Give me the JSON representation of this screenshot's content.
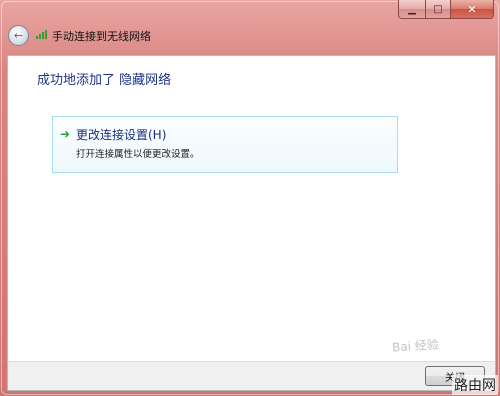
{
  "window": {
    "minimize_glyph": "▁",
    "maximize_glyph": "□",
    "close_glyph": "✕"
  },
  "header": {
    "back_icon": "back-arrow-icon",
    "network_icon": "wireless-signal-icon",
    "title": "手动连接到无线网络"
  },
  "main": {
    "heading": "成功地添加了 隐藏网络",
    "option": {
      "icon": "green-arrow-icon",
      "title": "更改连接设置(H)",
      "description": "打开连接属性以便更改设置。"
    }
  },
  "footer": {
    "close_label": "关闭"
  },
  "watermark": {
    "text": "Bai 经验",
    "site_mark": "路由网"
  },
  "colors": {
    "frame": "#d98a88",
    "heading": "#1e3287",
    "option_border": "#a9dcee",
    "arrow": "#2aa33a"
  }
}
